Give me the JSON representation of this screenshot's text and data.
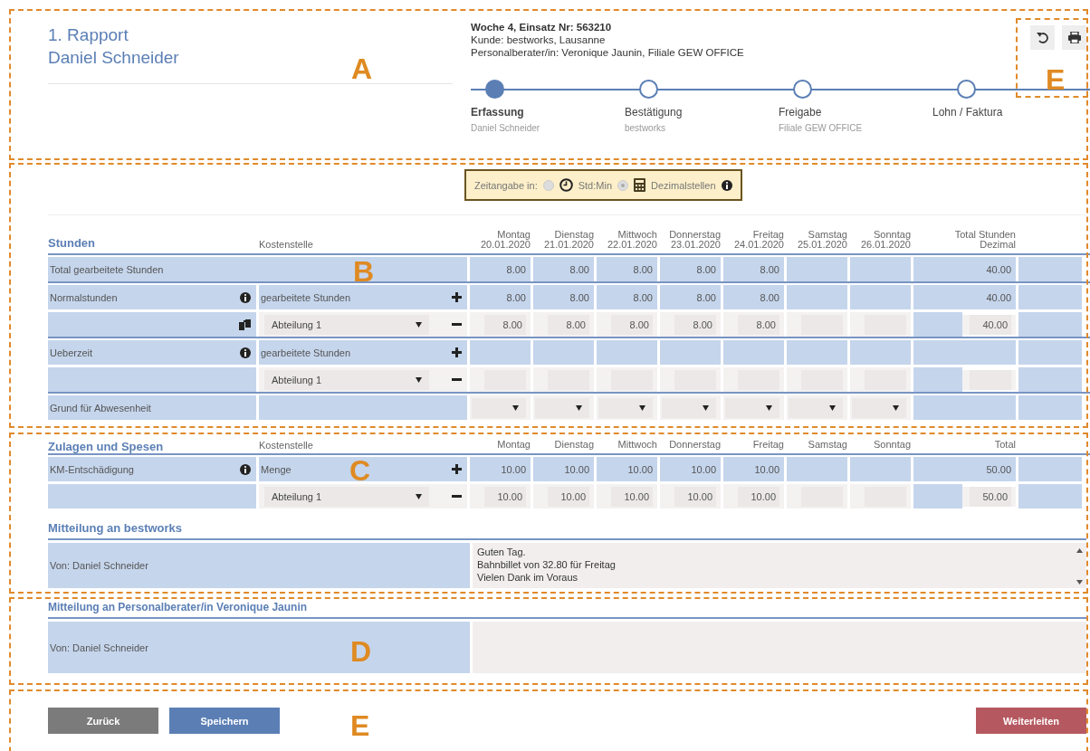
{
  "header": {
    "title": "1. Rapport",
    "person": "Daniel Schneider",
    "info": [
      "Woche 4, Einsatz Nr: 563210",
      "Kunde: bestworks, Lausanne",
      "Personalberater/in: Veronique Jaunin, Filiale GEW OFFICE"
    ],
    "steps": [
      {
        "title": "Erfassung",
        "subtitle": "Daniel Schneider",
        "selected": true
      },
      {
        "title": "Bestätigung",
        "subtitle": "bestworks",
        "selected": false
      },
      {
        "title": "Freigabe",
        "subtitle": "Filiale GEW OFFICE",
        "selected": false
      },
      {
        "title": "Lohn / Faktura",
        "selected": false
      }
    ]
  },
  "time_format": {
    "label": "Zeitangabe in:",
    "options": [
      {
        "label": "Std:Min",
        "selected": false
      },
      {
        "label": "Dezimalstellen",
        "selected": true
      }
    ]
  },
  "hours": {
    "title": "Stunden",
    "cost_center_header": "Kostenstelle",
    "total_header": "Total Stunden",
    "total_subheader": "Dezimal",
    "columns": [
      {
        "day": "Montag",
        "date": "20.01.2020"
      },
      {
        "day": "Dienstag",
        "date": "21.01.2020"
      },
      {
        "day": "Mittwoch",
        "date": "22.01.2020"
      },
      {
        "day": "Donnerstag",
        "date": "23.01.2020"
      },
      {
        "day": "Freitag",
        "date": "24.01.2020"
      },
      {
        "day": "Samstag",
        "date": "25.01.2020"
      },
      {
        "day": "Sonntag",
        "date": "26.01.2020"
      }
    ],
    "rows": [
      {
        "kind": "total",
        "label": "Total gearbeitete Stunden",
        "values": [
          "8.00",
          "8.00",
          "8.00",
          "8.00",
          "8.00"
        ],
        "total": "40.00"
      },
      {
        "kind": "main",
        "label": "Normalstunden",
        "cost_center": "gearbeitete Stunden",
        "values": [
          "8.00",
          "8.00",
          "8.00",
          "8.00",
          "8.00"
        ],
        "total": "40.00"
      },
      {
        "kind": "split",
        "copyable": true,
        "cost_center": "Abteilung 1",
        "values": [
          "8.00",
          "8.00",
          "8.00",
          "8.00",
          "8.00"
        ],
        "total": "40.00"
      },
      {
        "kind": "main",
        "label": "Ueberzeit",
        "cost_center": "gearbeitete Stunden"
      },
      {
        "kind": "split",
        "copyable": false,
        "cost_center": "Abteilung 1"
      },
      {
        "kind": "absence",
        "label": "Grund für Abwesenheit"
      }
    ]
  },
  "allowances": {
    "title": "Zulagen und Spesen",
    "cost_center_header": "Kostenstelle",
    "total_header": "Total",
    "columns": [
      {
        "day": "Montag"
      },
      {
        "day": "Dienstag"
      },
      {
        "day": "Mittwoch"
      },
      {
        "day": "Donnerstag"
      },
      {
        "day": "Freitag"
      },
      {
        "day": "Samstag"
      },
      {
        "day": "Sonntag"
      }
    ],
    "rows": [
      {
        "kind": "main",
        "label": "KM-Entschädigung",
        "cost_center": "Menge",
        "values": [
          "10.00",
          "10.00",
          "10.00",
          "10.00",
          "10.00"
        ],
        "total": "50.00"
      },
      {
        "kind": "split",
        "copyable": false,
        "cost_center": "Abteilung 1",
        "values": [
          "10.00",
          "10.00",
          "10.00",
          "10.00",
          "10.00"
        ],
        "total": "50.00"
      }
    ]
  },
  "messages": [
    {
      "title": "Mitteilung an bestworks",
      "from": "Von: Daniel Schneider",
      "lines": [
        "Guten Tag.",
        "Bahnbillet von 32.80 für Freitag",
        "Vielen Dank im Voraus"
      ]
    },
    {
      "title": "Mitteilung an Personalberater/in Veronique Jaunin",
      "from": "Von: Daniel Schneider"
    }
  ],
  "buttons": [
    {
      "label": "Zurück",
      "kind": "back"
    },
    {
      "label": "Speichern",
      "kind": "save"
    },
    {
      "label": "Weiterleiten",
      "kind": "forward"
    }
  ],
  "annotations": [
    {
      "label": "A"
    },
    {
      "label": "E"
    },
    {
      "label": "B"
    },
    {
      "label": "C"
    },
    {
      "label": "D"
    },
    {
      "label": "E"
    }
  ]
}
